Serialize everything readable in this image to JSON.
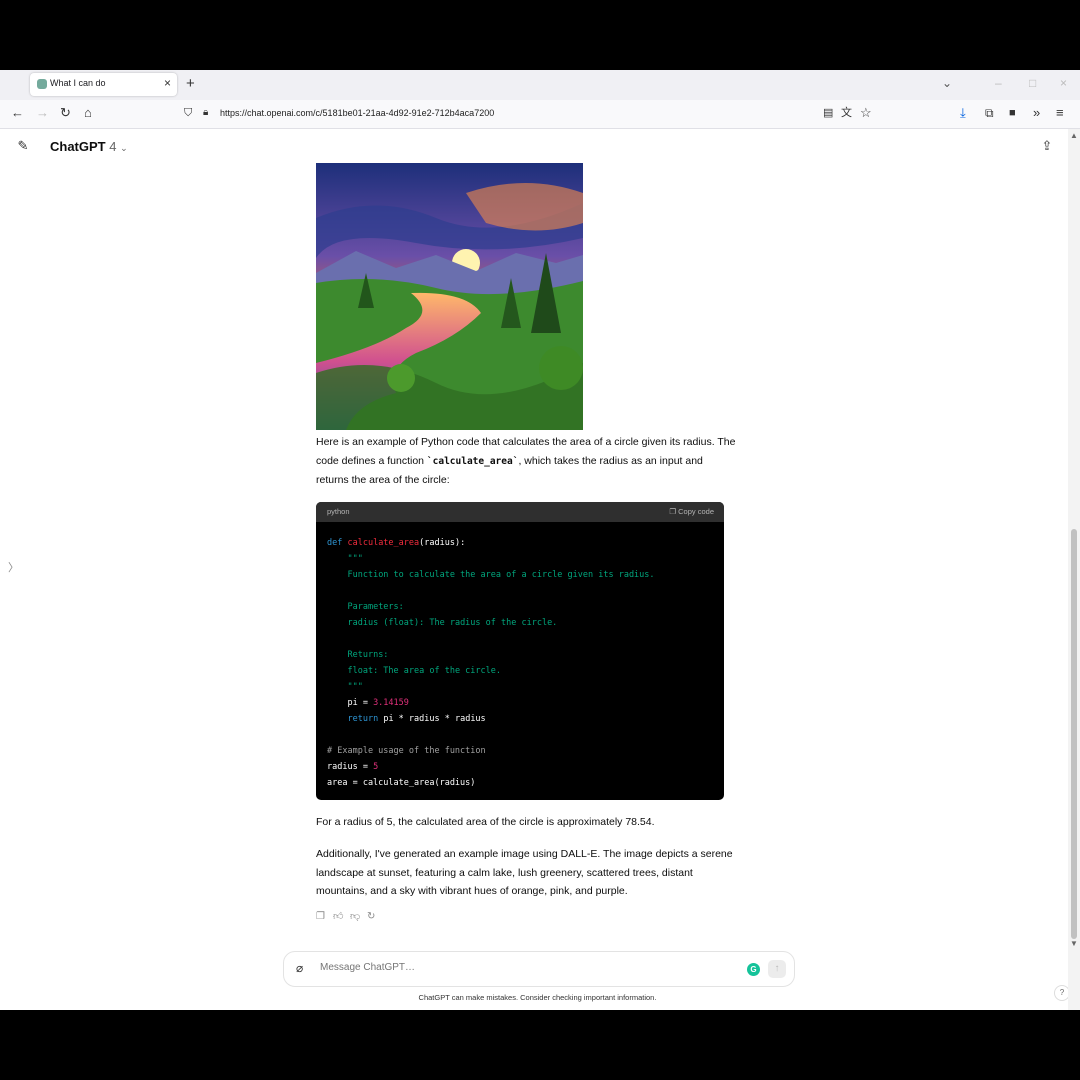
{
  "browser": {
    "tab_title": "What I can do",
    "url": "https://chat.openai.com/c/5181be01-21aa-4d92-91e2-712b4aca7200"
  },
  "header": {
    "model_name": "ChatGPT",
    "model_version": "4"
  },
  "message": {
    "intro": "Here is an example of Python code that calculates the area of a circle given its radius. The code defines a function ",
    "intro_code": "`calculate_area`",
    "intro_end": ", which takes the radius as an input and returns the area of the circle:",
    "code": {
      "language": "python",
      "copy_label": "Copy code"
    },
    "result": "For a radius of 5, the calculated area of the circle is approximately 78.54.",
    "image_note": "Additionally, I've generated an example image using DALL-E. The image depicts a serene landscape at sunset, featuring a calm lake, lush greenery, scattered trees, distant mountains, and a sky with vibrant hues of orange, pink, and purple."
  },
  "composer": {
    "placeholder": "Message ChatGPT…"
  },
  "footer": {
    "disclaimer": "ChatGPT can make mistakes. Consider checking important information.",
    "help": "?"
  }
}
